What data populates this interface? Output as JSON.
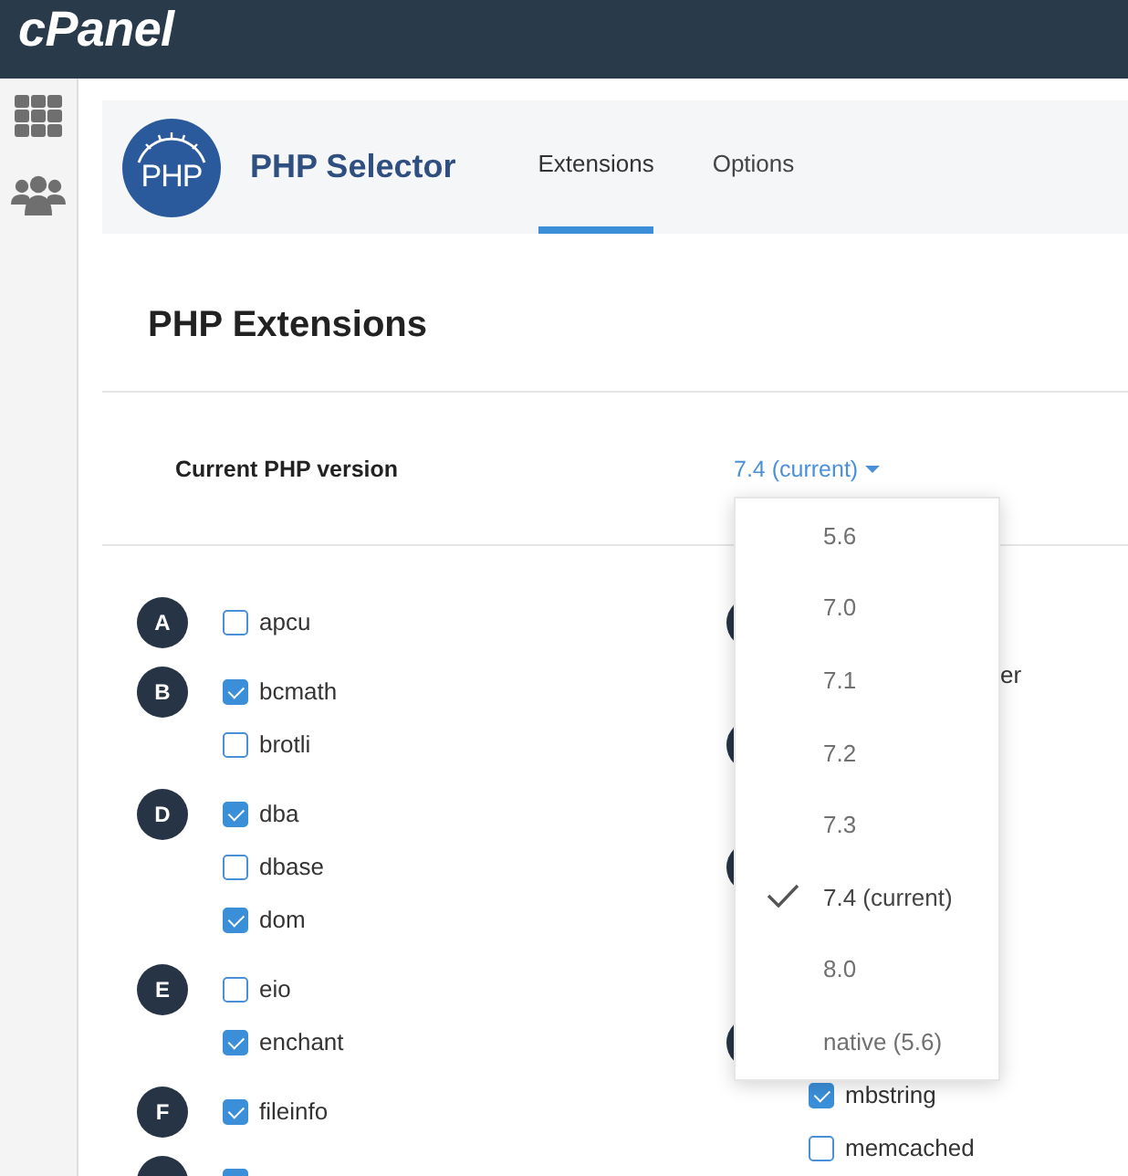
{
  "topbar": {
    "logo": "cPanel"
  },
  "header": {
    "logo_text": "PHP",
    "title": "PHP Selector",
    "tabs": [
      {
        "label": "Extensions",
        "selected": true
      },
      {
        "label": "Options",
        "selected": false
      }
    ]
  },
  "page_title": "PHP Extensions",
  "version": {
    "label": "Current PHP version",
    "value": "7.4 (current)",
    "menu": {
      "options": [
        {
          "label": "5.6",
          "selected": false
        },
        {
          "label": "7.0",
          "selected": false
        },
        {
          "label": "7.1",
          "selected": false
        },
        {
          "label": "7.2",
          "selected": false
        },
        {
          "label": "7.3",
          "selected": false
        },
        {
          "label": "7.4 (current)",
          "selected": true
        },
        {
          "label": "8.0",
          "selected": false
        },
        {
          "label": "native (5.6)",
          "selected": false
        }
      ]
    }
  },
  "extensions": {
    "left": [
      {
        "letter": "A",
        "items": [
          {
            "name": "apcu",
            "checked": false
          }
        ]
      },
      {
        "letter": "B",
        "items": [
          {
            "name": "bcmath",
            "checked": true
          },
          {
            "name": "brotli",
            "checked": false
          }
        ]
      },
      {
        "letter": "D",
        "items": [
          {
            "name": "dba",
            "checked": true
          },
          {
            "name": "dbase",
            "checked": false
          },
          {
            "name": "dom",
            "checked": true
          }
        ]
      },
      {
        "letter": "E",
        "items": [
          {
            "name": "eio",
            "checked": false
          },
          {
            "name": "enchant",
            "checked": true
          }
        ]
      },
      {
        "letter": "F",
        "items": [
          {
            "name": "fileinfo",
            "checked": true
          }
        ]
      },
      {
        "items": [
          {
            "checked": true
          }
        ]
      }
    ],
    "right": [
      {
        "kind": "covered",
        "name": "er"
      },
      {
        "kind": "checkbox",
        "name": "mbstring",
        "checked": true
      },
      {
        "kind": "checkbox",
        "name": "memcached",
        "checked": false
      }
    ]
  }
}
